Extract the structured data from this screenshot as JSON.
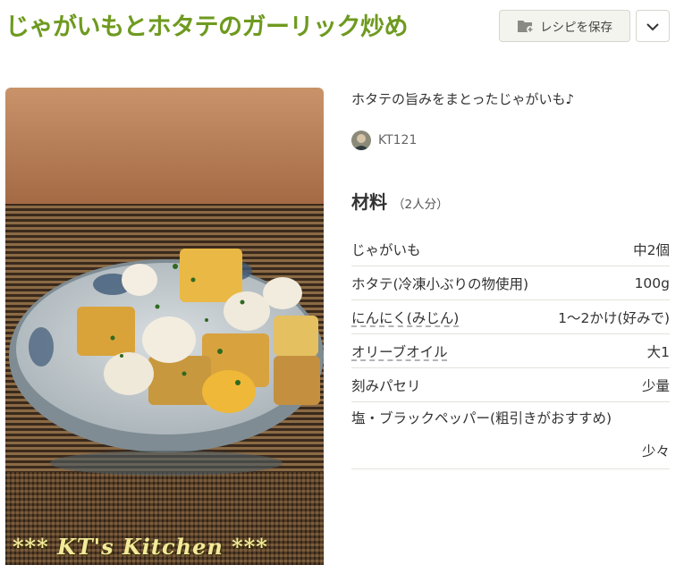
{
  "recipe": {
    "title": "じゃがいもとホタテのガーリック炒め",
    "description": "ホタテの旨みをまとったじゃがいも♪",
    "author": "KT121",
    "photo_watermark": "*** KT's Kitchen ***"
  },
  "actions": {
    "save_label": "レシピを保存",
    "save_icon": "folder-plus-icon",
    "menu_icon": "chevron-down-icon"
  },
  "ingredients": {
    "title": "材料",
    "servings": "（2人分）",
    "items": [
      {
        "name": "じゃがいも",
        "qty": "中2個"
      },
      {
        "name": "ホタテ(冷凍小ぶりの物使用)",
        "qty": "100g"
      },
      {
        "name": "にんにく(みじん)",
        "qty": "1～2かけ(好みで)"
      },
      {
        "name": "オリーブオイル",
        "qty": "大1"
      },
      {
        "name": "刻みパセリ",
        "qty": "少量"
      },
      {
        "name": "塩・ブラックペッパー(粗引きがおすすめ)",
        "qty": "少々"
      }
    ]
  },
  "colors": {
    "title": "#6e9a1f",
    "button_bg": "#f4f4ef",
    "divider": "#e2e2dc"
  }
}
